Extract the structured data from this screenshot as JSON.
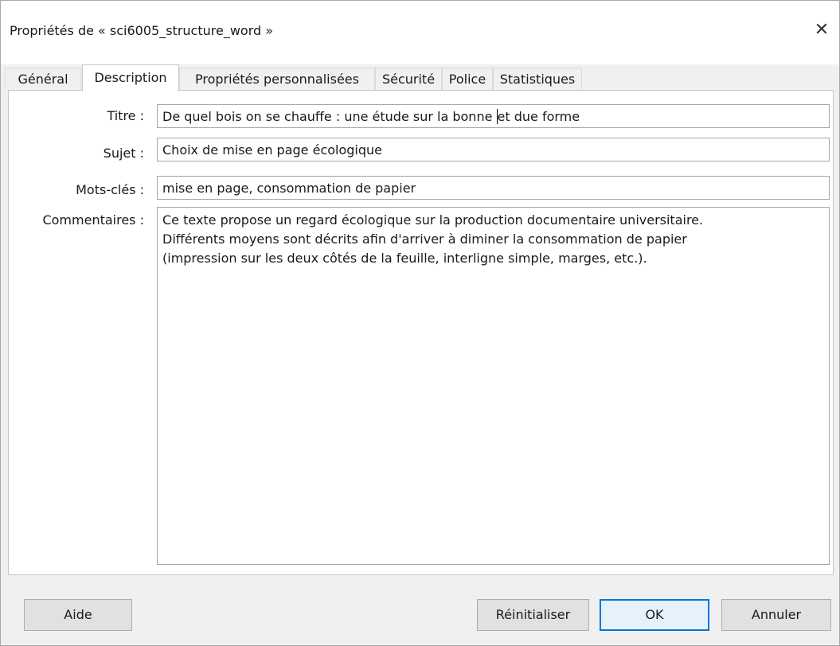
{
  "window": {
    "title": "Propriétés de « sci6005_structure_word »",
    "close_glyph": "✕"
  },
  "tabs": [
    {
      "label": "Général",
      "active": false
    },
    {
      "label": "Description",
      "active": true
    },
    {
      "label": "Propriétés personnalisées",
      "active": false
    },
    {
      "label": "Sécurité",
      "active": false
    },
    {
      "label": "Police",
      "active": false
    },
    {
      "label": "Statistiques",
      "active": false
    }
  ],
  "form": {
    "title_label": "Titre :",
    "title_value_before_cursor": "De quel bois on se chauffe : une étude sur la bonne ",
    "title_value_after_cursor": "et due forme",
    "subject_label": "Sujet :",
    "subject_value": "Choix de mise en page écologique",
    "keywords_label": "Mots-clés :",
    "keywords_value": "mise en page, consommation de papier",
    "comments_label": "Commentaires :",
    "comments_lines": [
      "Ce texte propose un regard écologique sur la production documentaire universitaire.",
      "Différents moyens sont décrits afin d'arriver à diminer la consommation de papier",
      "(impression sur les deux côtés de la feuille, interligne simple, marges, etc.)."
    ]
  },
  "buttons": {
    "help": "Aide",
    "reset": "Réinitialiser",
    "ok": "OK",
    "cancel": "Annuler"
  },
  "colors": {
    "default_button_border": "#0078d7",
    "dialog_background": "#f0f0f0"
  }
}
